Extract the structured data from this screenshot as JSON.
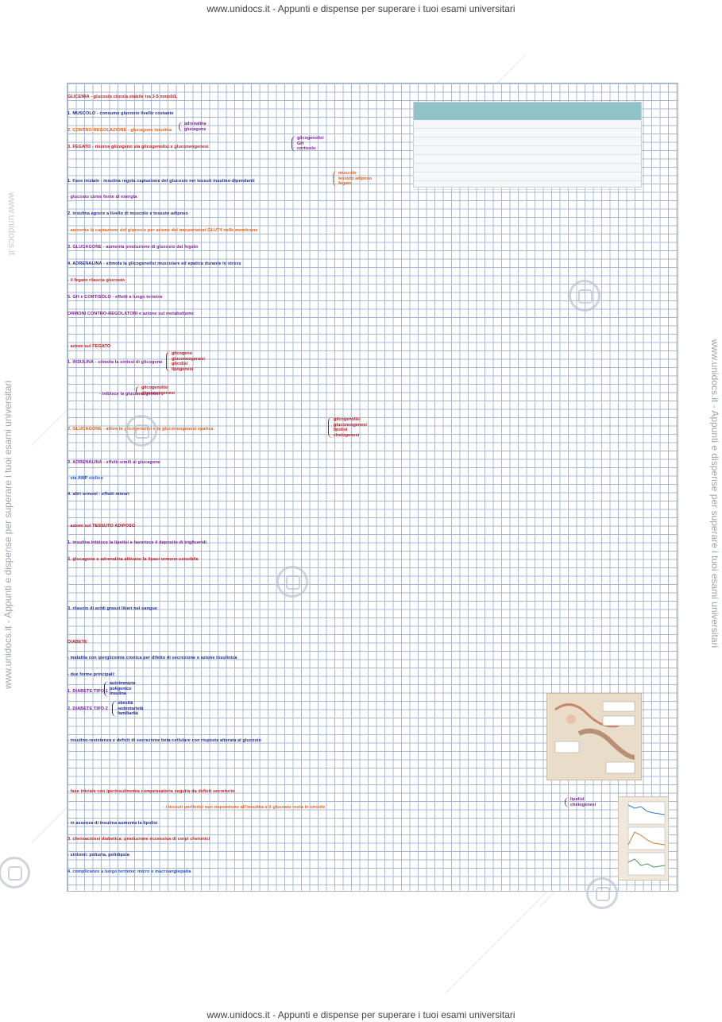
{
  "banner": {
    "top": "www.unidocs.it - Appunti e dispense per superare i tuoi esami universitari",
    "bottom": "www.unidocs.it - Appunti e dispense per superare i tuoi esami universitari"
  },
  "side_watermark": {
    "left": "www.unidocs.it - Appunti e dispense per superare i tuoi esami universitari",
    "right": "www.unidocs.it - Appunti e dispense per superare i tuoi esami universitari",
    "left_small": "www.unidocs.it"
  },
  "notes": {
    "l1": "GLICEMIA - glucosio circola stabile tra 3-5 mmoli/L",
    "l2": "1. MUSCOLO - consumo glucosio livello costante",
    "l3": "2. CONTRO-REGOLAZIONE - glucagone insulina",
    "l4": "3. FEGATO - riserva glicogeno via glicogenolisi e gluconeogenesi",
    "l5": "1. Fase iniziale - insulina regola captazione del glucosio nei tessuti insulino-dipendenti",
    "l6": "- glucosio come fonte di energia",
    "l7": "2. insulina agisce a livello di muscolo e tessuto adiposo",
    "l8": "- aumenta la captazione del glucosio per azione dei trasportatori GLUT4 nelle membrane",
    "l9": "3. GLUCAGONE - aumenta produzione di glucosio dal fegato",
    "l10": "4. ADRENALINA - stimola la glicogenolisi muscolare ed epatica durante lo stress",
    "l11": "- il fegato rilascia glucosio",
    "l12": "5. GH e CORTISOLO - effetti a lungo termine",
    "l13": "ORMONI CONTRO-REGOLATORI e azione sul metabolismo",
    "l14": "- azioni sul FEGATO",
    "l15": "1. INSULINA - stimola la sintesi di glicogeno",
    "l16": "- inibisce la gluconeogenesi",
    "l17": "2. GLUCAGONE - attiva la glicogenolisi e la gluconeogenesi epatica",
    "l18": "3. ADRENALINA - effetti simili al glucagone",
    "l19": "- via AMP ciclico",
    "l20": "4. altri ormoni - effetti minori",
    "l21": "- azioni sul TESSUTO ADIPOSO",
    "l22": "1. insulina inibisce la lipolisi e favorisce il deposito di trigliceridi",
    "l23": "2. glucagone e adrenalina attivano la lipasi ormone-sensibile",
    "l24": "3. rilascio di acidi grassi liberi nel sangue",
    "l25": "DIABETE",
    "l26": "- malattia con iperglicemia cronica per difetto di secrezione o azione insulinica",
    "l27": "- due forme principali:",
    "l28": "1. DIABETE TIPO 1",
    "l29": "2. DIABETE TIPO 2",
    "l30": "- insulino-resistenza e deficit di secrezione beta-cellulare con risposta alterata al glucosio",
    "l31": "- fase iniziale con iperinsulinemia compensatoria seguita da deficit secretorio",
    "l32": "- i tessuti periferici non rispondono all'insulina e il glucosio resta in circolo",
    "l33": "- in assenza di insulina aumenta la lipolisi",
    "l34": "3. chetoacidosi diabetica: produzione eccessiva di corpi chetonici",
    "l35": "- sintomi: poliuria, polidipsia",
    "l36": "4. complicanze a lungo termine: micro e macroangiopatia"
  },
  "braces": {
    "b1": [
      "adrenalina",
      "glucagone"
    ],
    "b2": [
      "glicogenolisi",
      "GH",
      "cortisolo"
    ],
    "b3": [
      "muscolo",
      "tessuto adiposo",
      "fegato"
    ],
    "b4": [
      "glicogeno",
      "gluconeogenesi",
      "glicolisi",
      "lipogenesi"
    ],
    "b5": [
      "glicogenolisi",
      "gluconeogenesi"
    ],
    "b6": [
      "glicogenolisi",
      "gluconeogenesi",
      "lipolisi",
      "chetogenesi"
    ],
    "b7": [
      "autoimmune",
      "poligenico",
      "insulina"
    ],
    "b8": [
      "obesità",
      "sedentarietà",
      "familiarità"
    ],
    "b9": [
      "lipolisi",
      "chetogenesi"
    ]
  },
  "colors": {
    "red": "#c0161b",
    "purple": "#7c1f9a",
    "orange": "#e0601a",
    "navy": "#1b2a8a",
    "blue": "#1a4fd0",
    "grid": "#a9b9d4"
  }
}
